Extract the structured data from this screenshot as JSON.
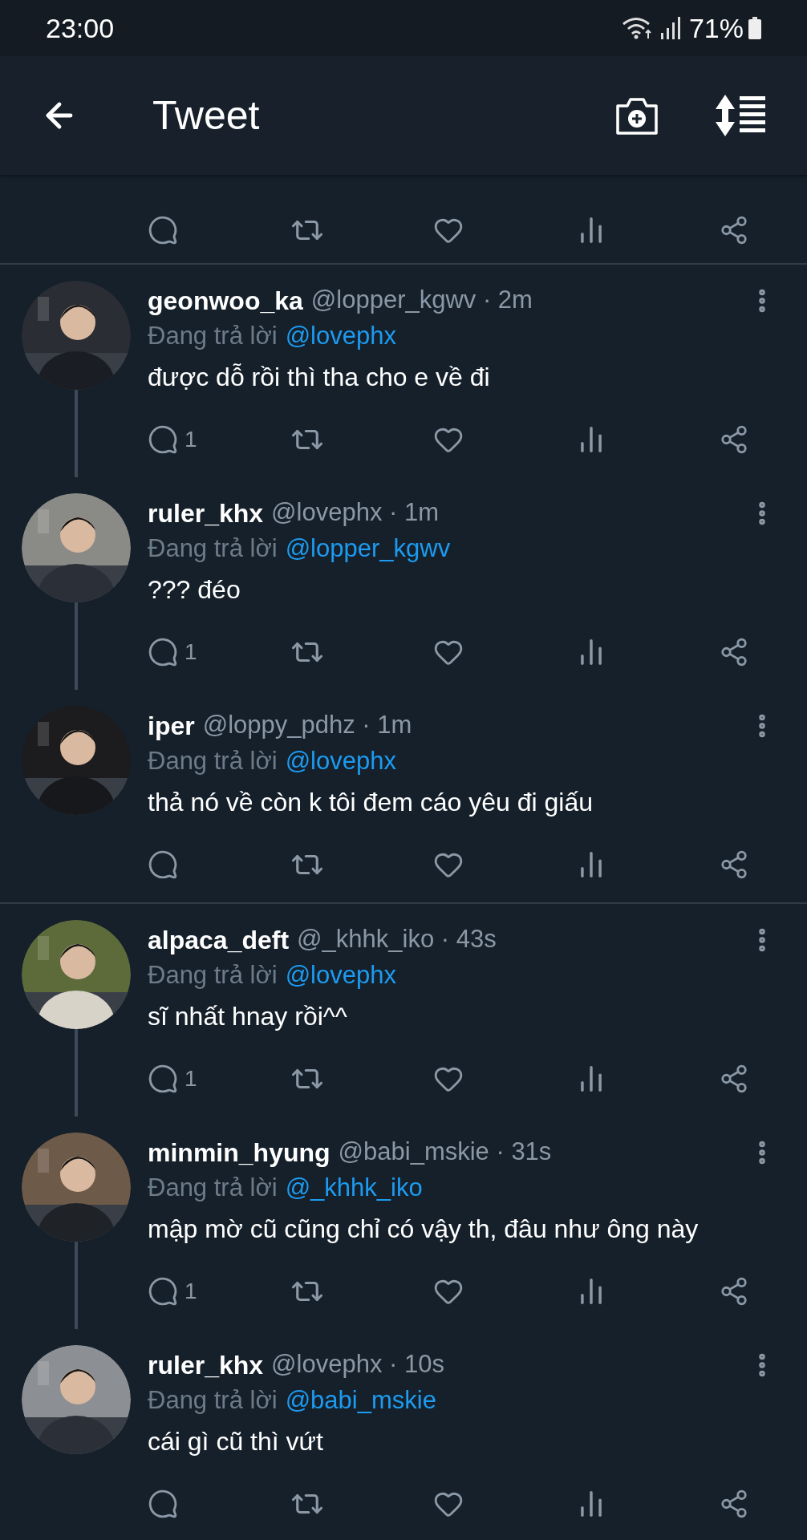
{
  "status_bar": {
    "time": "23:00",
    "battery": "71%"
  },
  "header": {
    "title": "Tweet"
  },
  "groups": [
    {
      "tweets": [
        {
          "name": "geonwoo_ka",
          "meta": "@lopper_kgwv · 2m",
          "reply_label": "Đang trả lời",
          "reply_to": "@lovephx",
          "text": "được dỗ rồi thì tha cho e về đi",
          "reply_count": "1"
        },
        {
          "name": "ruler_khx",
          "meta": "@lovephx · 1m",
          "reply_label": "Đang trả lời",
          "reply_to": "@lopper_kgwv",
          "text": "??? đéo",
          "reply_count": "1"
        },
        {
          "name": "iper",
          "meta": "@loppy_pdhz · 1m",
          "reply_label": "Đang trả lời",
          "reply_to": "@lovephx",
          "text": "thả nó về còn k tôi đem cáo yêu đi giấu"
        }
      ]
    },
    {
      "tweets": [
        {
          "name": "alpaca_deft",
          "meta": "@_khhk_iko · 43s",
          "reply_label": "Đang trả lời",
          "reply_to": "@lovephx",
          "text": "sĩ nhất hnay rồi^^",
          "reply_count": "1"
        },
        {
          "name": "minmin_hyung",
          "meta": "@babi_mskie · 31s",
          "reply_label": "Đang trả lời",
          "reply_to": "@_khhk_iko",
          "text": "mập mờ cũ cũng chỉ có vậy th, đâu như ông này",
          "reply_count": "1"
        },
        {
          "name": "ruler_khx",
          "meta": "@lovephx · 10s",
          "reply_label": "Đang trả lời",
          "reply_to": "@babi_mskie",
          "text": "cái gì cũ thì vứt"
        }
      ]
    }
  ]
}
